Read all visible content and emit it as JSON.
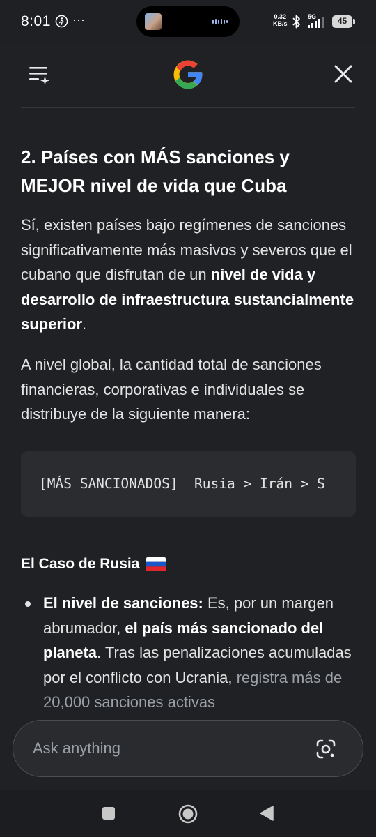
{
  "status_bar": {
    "time": "8:01",
    "dots": "···",
    "speed_value": "0.32",
    "speed_unit": "KB/s",
    "network": "5G",
    "battery": "45"
  },
  "header": {
    "menu_icon": "menu-sparkle-icon",
    "logo": "google-g-logo",
    "close_icon": "close-icon"
  },
  "content": {
    "heading": "2. Países con MÁS sanciones y MEJOR nivel de vida que Cuba",
    "para1": {
      "text_a": "Sí, existen países bajo regímenes de sanciones significativamente más masivos y severos que el cubano que disfrutan de un ",
      "bold": "nivel de vida y desarrollo de infraestructura sustancialmente superior",
      "text_b": "."
    },
    "para2": "A nivel global, la cantidad total de sanciones financieras, corporativas e individuales se distribuye de la siguiente manera:",
    "code": "[MÁS SANCIONADOS]  Rusia > Irán > S",
    "subheading": "El Caso de Rusia",
    "flag": "russia-flag",
    "bullets": [
      {
        "bold_label": "El nivel de sanciones:",
        "text_a": " Es, por un margen abrumador, ",
        "bold_mid": "el país más sancionado del planeta",
        "text_b": ". Tras las penalizaciones acumuladas por el conflicto con Ucrania, ",
        "faded": "registra más de 20,000 sanciones activas"
      }
    ]
  },
  "ask_bar": {
    "placeholder": "Ask anything",
    "lens_icon": "google-lens-icon"
  },
  "nav_bar": {
    "recents": "recents-square-icon",
    "home": "home-circle-icon",
    "back": "back-triangle-icon"
  },
  "colors": {
    "background": "#202124",
    "text": "#e3e3e3",
    "code_bg": "#2b2c30",
    "ask_bg": "#2a2b2f",
    "google_blue": "#4285F4",
    "google_red": "#EA4335",
    "google_yellow": "#FBBC05",
    "google_green": "#34A853"
  }
}
